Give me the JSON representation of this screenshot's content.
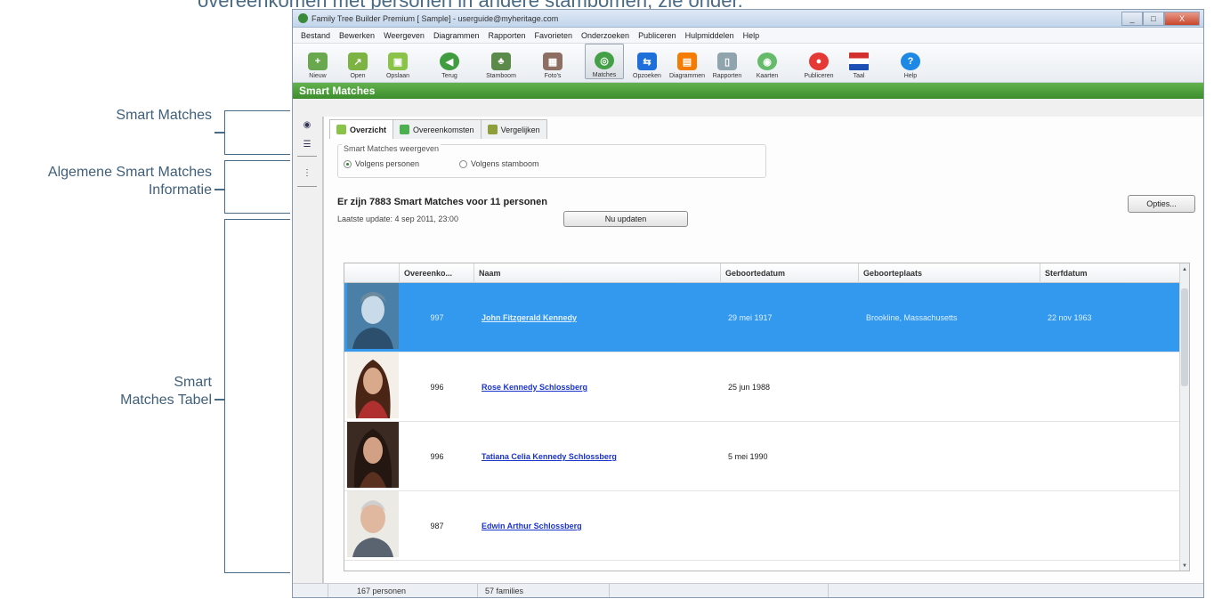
{
  "top_text": "overeenkomen met personen in andere stambomen, zie onder.",
  "callouts": {
    "smart_matches": "Smart Matches",
    "general_info_line1": "Algemene Smart Matches",
    "general_info_line2": "Informatie",
    "table_line1": "Smart",
    "table_line2": "Matches Tabel"
  },
  "window": {
    "title": "Family Tree Builder Premium [ Sample] - userguide@myheritage.com",
    "controls": {
      "minimize": "_",
      "maximize": "□",
      "close": "X"
    }
  },
  "menu": [
    "Bestand",
    "Bewerken",
    "Weergeven",
    "Diagrammen",
    "Rapporten",
    "Favorieten",
    "Onderzoeken",
    "Publiceren",
    "Hulpmiddelen",
    "Help"
  ],
  "toolbar": [
    {
      "label": "Nieuw",
      "icon": "new-icon",
      "color": "#6aa84f"
    },
    {
      "label": "Open",
      "icon": "open-icon",
      "color": "#7cb342"
    },
    {
      "label": "Opslaan",
      "icon": "save-icon",
      "color": "#8bc34a"
    },
    {
      "label": "Terug",
      "icon": "back-icon",
      "color": "#3f9d3f"
    },
    {
      "label": "Stamboom",
      "icon": "tree-icon",
      "color": "#5b8a4a"
    },
    {
      "label": "Foto's",
      "icon": "photos-icon",
      "color": "#8d6e63"
    },
    {
      "label": "Matches",
      "icon": "matches-icon",
      "color": "#43a047"
    },
    {
      "label": "Opzoeken",
      "icon": "search-icon",
      "color": "#1e6fd9"
    },
    {
      "label": "Diagrammen",
      "icon": "charts-icon",
      "color": "#f57c00"
    },
    {
      "label": "Rapporten",
      "icon": "reports-icon",
      "color": "#90a4ae"
    },
    {
      "label": "Kaarten",
      "icon": "maps-icon",
      "color": "#66bb6a"
    },
    {
      "label": "Publiceren",
      "icon": "publish-icon",
      "color": "#e53935"
    },
    {
      "label": "Taal",
      "icon": "language-flag-icon",
      "color": "#d32f2f"
    },
    {
      "label": "Help",
      "icon": "help-icon",
      "color": "#1e88e5"
    }
  ],
  "section_header": "Smart Matches",
  "tabs": [
    {
      "label": "Overzicht",
      "active": true
    },
    {
      "label": "Overeenkomsten",
      "active": false
    },
    {
      "label": "Vergelijken",
      "active": false
    }
  ],
  "display_group": {
    "title": "Smart Matches weergeven",
    "option_persons": "Volgens personen",
    "option_tree": "Volgens stamboom",
    "selected": "Volgens personen"
  },
  "summary": "Er zijn 7883 Smart Matches voor 11 personen",
  "last_update": "Laatste update: 4 sep 2011, 23:00",
  "update_button": "Nu updaten",
  "options_button": "Opties...",
  "table": {
    "columns": [
      "",
      "Overeenko...",
      "Naam",
      "Geboortedatum",
      "Geboorteplaats",
      "Sterfdatum"
    ],
    "rows": [
      {
        "score": "997",
        "name": "John Fitzgerald Kennedy",
        "birth_date": "29 mei 1917",
        "birth_place": "Brookline, Massachusetts",
        "death_date": "22 nov 1963",
        "selected": true
      },
      {
        "score": "996",
        "name": "Rose Kennedy Schlossberg",
        "birth_date": "25 jun 1988",
        "birth_place": "",
        "death_date": "",
        "selected": false
      },
      {
        "score": "996",
        "name": "Tatiana Celia Kennedy Schlossberg",
        "birth_date": "5 mei 1990",
        "birth_place": "",
        "death_date": "",
        "selected": false
      },
      {
        "score": "987",
        "name": "Edwin Arthur Schlossberg",
        "birth_date": "",
        "birth_place": "",
        "death_date": "",
        "selected": false
      }
    ]
  },
  "status": {
    "persons": "167 personen",
    "families": "57 families"
  }
}
